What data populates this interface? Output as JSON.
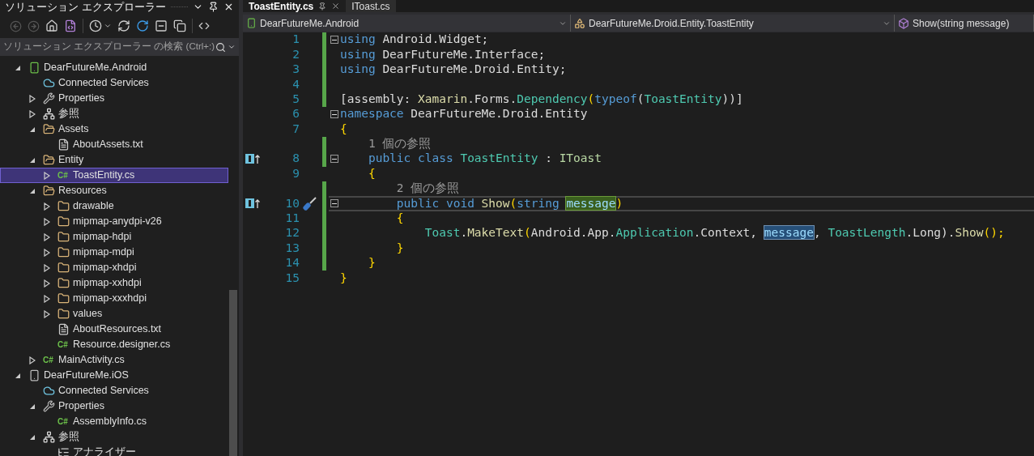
{
  "explorer": {
    "title": "ソリューション エクスプローラー",
    "search": {
      "placeholder": "ソリューション エクスプローラー の検索 (Ctrl+:)"
    },
    "tree": [
      {
        "label": "DearFutureMe.Android",
        "kind": "android",
        "expanded": true,
        "selected": false,
        "children": [
          {
            "label": "Connected Services",
            "kind": "cloud",
            "selected": false
          },
          {
            "label": "Properties",
            "kind": "wrench",
            "expanded": false,
            "selected": false
          },
          {
            "label": "参照",
            "kind": "refs",
            "expanded": false,
            "selected": false
          },
          {
            "label": "Assets",
            "kind": "folder-open",
            "expanded": true,
            "selected": false,
            "children": [
              {
                "label": "AboutAssets.txt",
                "kind": "text",
                "selected": false
              }
            ]
          },
          {
            "label": "Entity",
            "kind": "folder-open",
            "expanded": true,
            "selected": false,
            "children": [
              {
                "label": "ToastEntity.cs",
                "kind": "csharp",
                "badge": "C#",
                "expanded": false,
                "selected": true
              }
            ]
          },
          {
            "label": "Resources",
            "kind": "folder-open",
            "expanded": true,
            "selected": false,
            "children": [
              {
                "label": "drawable",
                "kind": "folder",
                "expanded": false,
                "selected": false
              },
              {
                "label": "mipmap-anydpi-v26",
                "kind": "folder",
                "expanded": false,
                "selected": false
              },
              {
                "label": "mipmap-hdpi",
                "kind": "folder",
                "expanded": false,
                "selected": false
              },
              {
                "label": "mipmap-mdpi",
                "kind": "folder",
                "expanded": false,
                "selected": false
              },
              {
                "label": "mipmap-xhdpi",
                "kind": "folder",
                "expanded": false,
                "selected": false
              },
              {
                "label": "mipmap-xxhdpi",
                "kind": "folder",
                "expanded": false,
                "selected": false
              },
              {
                "label": "mipmap-xxxhdpi",
                "kind": "folder",
                "expanded": false,
                "selected": false
              },
              {
                "label": "values",
                "kind": "folder",
                "expanded": false,
                "selected": false
              },
              {
                "label": "AboutResources.txt",
                "kind": "text",
                "selected": false
              },
              {
                "label": "Resource.designer.cs",
                "kind": "csharp",
                "badge": "C#",
                "selected": false
              }
            ]
          },
          {
            "label": "MainActivity.cs",
            "kind": "csharp",
            "badge": "C#",
            "expanded": false,
            "selected": false
          }
        ]
      },
      {
        "label": "DearFutureMe.iOS",
        "kind": "ios",
        "expanded": true,
        "selected": false,
        "children": [
          {
            "label": "Connected Services",
            "kind": "cloud",
            "selected": false
          },
          {
            "label": "Properties",
            "kind": "wrench",
            "expanded": true,
            "selected": false,
            "children": [
              {
                "label": "AssemblyInfo.cs",
                "kind": "csharp",
                "badge": "C#",
                "selected": false
              }
            ]
          },
          {
            "label": "参照",
            "kind": "refs",
            "expanded": true,
            "selected": false,
            "children": [
              {
                "label": "アナライザー",
                "kind": "analyzer",
                "selected": false
              }
            ]
          }
        ]
      }
    ]
  },
  "tabs": [
    {
      "label": "ToastEntity.cs",
      "selected": true
    },
    {
      "label": "IToast.cs",
      "selected": false
    }
  ],
  "navbar": [
    {
      "label": "DearFutureMe.Android",
      "kind": "android"
    },
    {
      "label": "DearFutureMe.Droid.Entity.ToastEntity",
      "kind": "class"
    },
    {
      "label": "Show(string message)",
      "kind": "method"
    }
  ],
  "code": [
    {
      "kind": "code",
      "number": "1",
      "changed": true,
      "fold": true,
      "impl": false,
      "quick": false,
      "current": false,
      "tokens": [
        {
          "text": "using ",
          "kind": "keyword"
        },
        {
          "text": "Android.Widget;",
          "kind": "plain"
        }
      ]
    },
    {
      "kind": "code",
      "number": "2",
      "changed": true,
      "fold": false,
      "impl": false,
      "quick": false,
      "current": false,
      "tokens": [
        {
          "text": "using ",
          "kind": "keyword"
        },
        {
          "text": "DearFutureMe.Interface;",
          "kind": "plain"
        }
      ]
    },
    {
      "kind": "code",
      "number": "3",
      "changed": true,
      "fold": false,
      "impl": false,
      "quick": false,
      "current": false,
      "tokens": [
        {
          "text": "using ",
          "kind": "keyword"
        },
        {
          "text": "DearFutureMe.Droid.Entity;",
          "kind": "plain"
        }
      ]
    },
    {
      "kind": "code",
      "number": "4",
      "changed": true,
      "fold": false,
      "impl": false,
      "quick": false,
      "current": false
    },
    {
      "kind": "code",
      "number": "5",
      "changed": true,
      "fold": false,
      "impl": false,
      "quick": false,
      "current": false,
      "tokens": [
        {
          "text": "[assembly: ",
          "kind": "plain"
        },
        {
          "text": "Xamarin",
          "kind": "method"
        },
        {
          "text": ".Forms.",
          "kind": "plain"
        },
        {
          "text": "Dependency",
          "kind": "type"
        },
        {
          "text": "(",
          "kind": "brace"
        },
        {
          "text": "typeof",
          "kind": "keyword"
        },
        {
          "text": "(",
          "kind": "plain"
        },
        {
          "text": "ToastEntity",
          "kind": "type"
        },
        {
          "text": "))]",
          "kind": "plain"
        }
      ]
    },
    {
      "kind": "code",
      "number": "6",
      "changed": false,
      "fold": true,
      "impl": false,
      "quick": false,
      "current": false,
      "tokens": [
        {
          "text": "namespace ",
          "kind": "keyword"
        },
        {
          "text": "DearFutureMe.Droid.Entity",
          "kind": "plain"
        }
      ]
    },
    {
      "kind": "code",
      "number": "7",
      "changed": false,
      "fold": false,
      "impl": false,
      "quick": false,
      "current": false,
      "tokens": [
        {
          "text": "{",
          "kind": "brace"
        }
      ]
    },
    {
      "kind": "lens",
      "text": "    1 個の参照",
      "changed": true
    },
    {
      "kind": "code",
      "number": "8",
      "changed": true,
      "fold": true,
      "impl": true,
      "quick": false,
      "current": false,
      "tokens": [
        {
          "text": "    public class ",
          "kind": "keyword"
        },
        {
          "text": "ToastEntity",
          "kind": "type"
        },
        {
          "text": " : ",
          "kind": "plain"
        },
        {
          "text": "IToast",
          "kind": "interface"
        }
      ]
    },
    {
      "kind": "code",
      "number": "9",
      "changed": false,
      "fold": false,
      "impl": false,
      "quick": false,
      "current": false,
      "tokens": [
        {
          "text": "    {",
          "kind": "brace"
        }
      ]
    },
    {
      "kind": "lens",
      "text": "        2 個の参照",
      "changed": true
    },
    {
      "kind": "code",
      "number": "10",
      "changed": true,
      "fold": true,
      "impl": true,
      "quick": true,
      "current": true,
      "tokens": [
        {
          "text": "        public void ",
          "kind": "keyword"
        },
        {
          "text": "Show",
          "kind": "method"
        },
        {
          "text": "(",
          "kind": "brace"
        },
        {
          "text": "string ",
          "kind": "keyword"
        },
        {
          "text": "message",
          "kind": "definition"
        },
        {
          "text": ")",
          "kind": "brace"
        }
      ]
    },
    {
      "kind": "code",
      "number": "11",
      "changed": true,
      "fold": false,
      "impl": false,
      "quick": false,
      "current": false,
      "tokens": [
        {
          "text": "        {",
          "kind": "brace"
        }
      ]
    },
    {
      "kind": "code",
      "number": "12",
      "changed": true,
      "fold": false,
      "impl": false,
      "quick": false,
      "current": false,
      "tokens": [
        {
          "text": "            Toast",
          "kind": "type"
        },
        {
          "text": ".",
          "kind": "plain"
        },
        {
          "text": "MakeText",
          "kind": "method"
        },
        {
          "text": "(",
          "kind": "brace"
        },
        {
          "text": "Android.App.",
          "kind": "plain"
        },
        {
          "text": "Application",
          "kind": "type"
        },
        {
          "text": ".Context, ",
          "kind": "plain"
        },
        {
          "text": "message",
          "kind": "reference"
        },
        {
          "text": ", ",
          "kind": "plain"
        },
        {
          "text": "ToastLength",
          "kind": "type"
        },
        {
          "text": ".Long).",
          "kind": "plain"
        },
        {
          "text": "Show",
          "kind": "method"
        },
        {
          "text": "();",
          "kind": "brace"
        }
      ]
    },
    {
      "kind": "code",
      "number": "13",
      "changed": true,
      "fold": false,
      "impl": false,
      "quick": false,
      "current": false,
      "tokens": [
        {
          "text": "        }",
          "kind": "brace"
        }
      ]
    },
    {
      "kind": "code",
      "number": "14",
      "changed": true,
      "fold": false,
      "impl": false,
      "quick": false,
      "current": false,
      "tokens": [
        {
          "text": "    }",
          "kind": "brace"
        }
      ]
    },
    {
      "kind": "code",
      "number": "15",
      "changed": false,
      "fold": false,
      "impl": false,
      "quick": false,
      "current": false,
      "tokens": [
        {
          "text": "}",
          "kind": "brace"
        }
      ]
    }
  ]
}
